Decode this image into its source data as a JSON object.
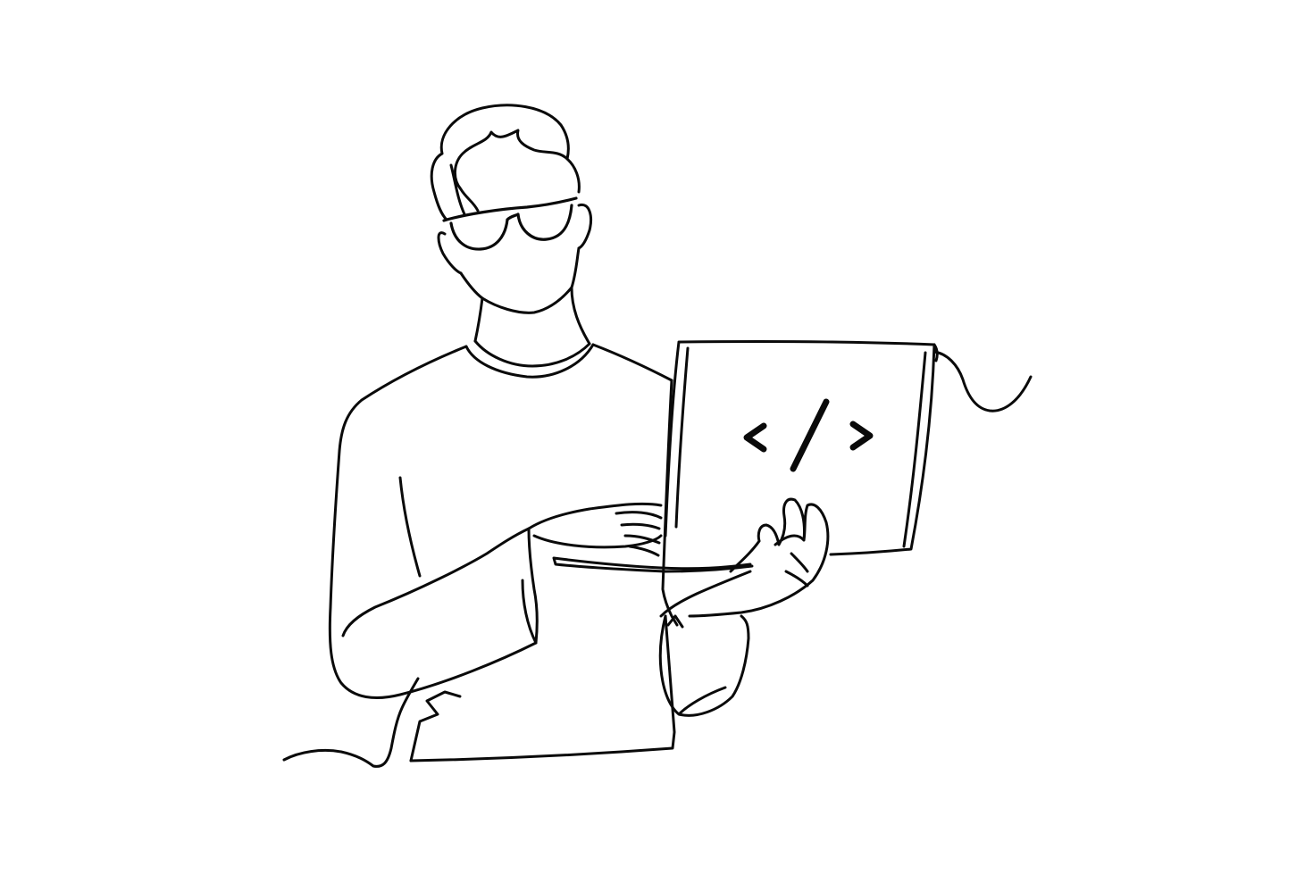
{
  "illustration": {
    "subject": "person-holding-laptop",
    "style": "continuous-line-drawing",
    "line_color": "#0a0a0a",
    "background_color": "#ffffff",
    "laptop_screen_symbol": "code-brackets-icon"
  }
}
